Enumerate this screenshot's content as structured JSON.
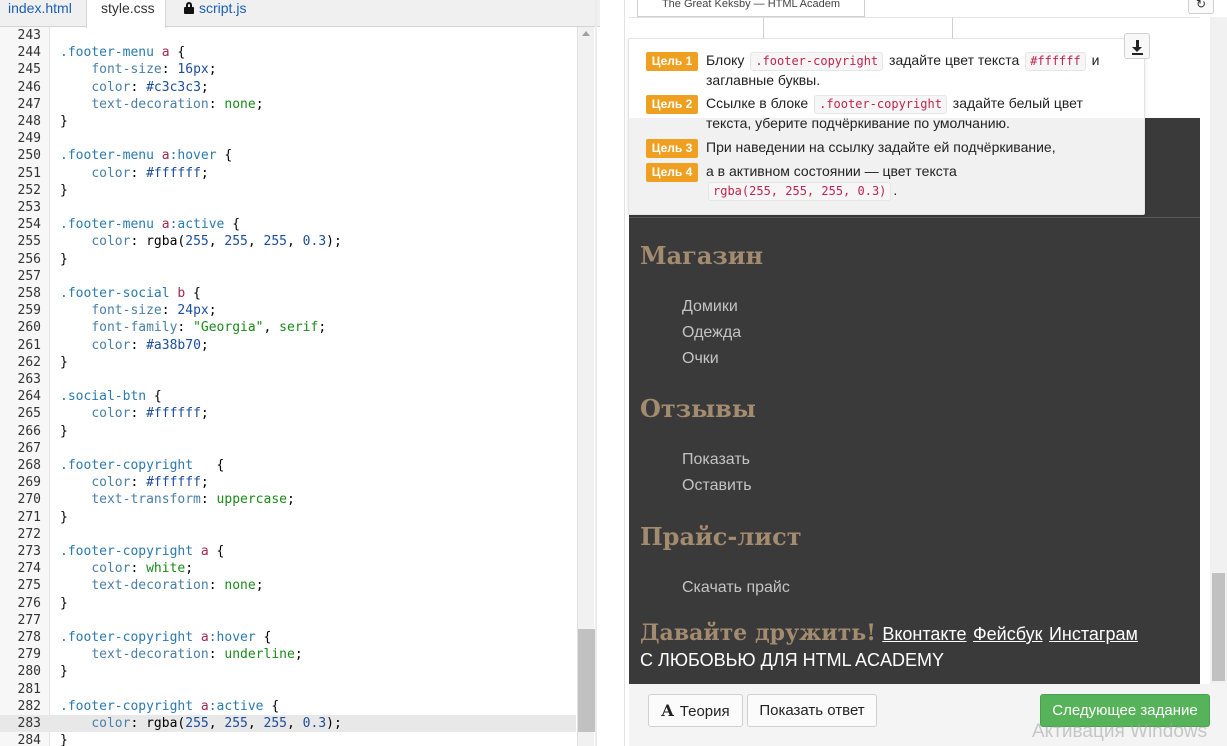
{
  "editor": {
    "tabs": [
      {
        "label": "index.html"
      },
      {
        "label": "style.css"
      },
      {
        "label": "script.js"
      }
    ],
    "lines": [
      {
        "n": "243",
        "tokens": []
      },
      {
        "n": "244",
        "tokens": [
          {
            "t": ".footer-menu",
            "c": "sel"
          },
          {
            "t": " "
          },
          {
            "t": "a",
            "c": "tag"
          },
          {
            "t": " {"
          }
        ]
      },
      {
        "n": "245",
        "tokens": [
          {
            "t": "    "
          },
          {
            "t": "font-size",
            "c": "prop"
          },
          {
            "t": ": "
          },
          {
            "t": "16px",
            "c": "num"
          },
          {
            "t": ";"
          }
        ]
      },
      {
        "n": "246",
        "tokens": [
          {
            "t": "    "
          },
          {
            "t": "color",
            "c": "prop"
          },
          {
            "t": ": "
          },
          {
            "t": "#c3c3c3",
            "c": "num"
          },
          {
            "t": ";"
          }
        ]
      },
      {
        "n": "247",
        "tokens": [
          {
            "t": "    "
          },
          {
            "t": "text-decoration",
            "c": "prop"
          },
          {
            "t": ": "
          },
          {
            "t": "none",
            "c": "kw"
          },
          {
            "t": ";"
          }
        ]
      },
      {
        "n": "248",
        "tokens": [
          {
            "t": "}"
          }
        ]
      },
      {
        "n": "249",
        "tokens": []
      },
      {
        "n": "250",
        "tokens": [
          {
            "t": ".footer-menu",
            "c": "sel"
          },
          {
            "t": " "
          },
          {
            "t": "a",
            "c": "tag"
          },
          {
            "t": ":hover",
            "c": "sel"
          },
          {
            "t": " {"
          }
        ]
      },
      {
        "n": "251",
        "tokens": [
          {
            "t": "    "
          },
          {
            "t": "color",
            "c": "prop"
          },
          {
            "t": ": "
          },
          {
            "t": "#ffffff",
            "c": "num"
          },
          {
            "t": ";"
          }
        ]
      },
      {
        "n": "252",
        "tokens": [
          {
            "t": "}"
          }
        ]
      },
      {
        "n": "253",
        "tokens": []
      },
      {
        "n": "254",
        "tokens": [
          {
            "t": ".footer-menu",
            "c": "sel"
          },
          {
            "t": " "
          },
          {
            "t": "a",
            "c": "tag"
          },
          {
            "t": ":active",
            "c": "sel"
          },
          {
            "t": " {"
          }
        ]
      },
      {
        "n": "255",
        "tokens": [
          {
            "t": "    "
          },
          {
            "t": "color",
            "c": "prop"
          },
          {
            "t": ": rgba("
          },
          {
            "t": "255",
            "c": "num"
          },
          {
            "t": ", "
          },
          {
            "t": "255",
            "c": "num"
          },
          {
            "t": ", "
          },
          {
            "t": "255",
            "c": "num"
          },
          {
            "t": ", "
          },
          {
            "t": "0.3",
            "c": "num"
          },
          {
            "t": ");"
          }
        ]
      },
      {
        "n": "256",
        "tokens": [
          {
            "t": "}"
          }
        ]
      },
      {
        "n": "257",
        "tokens": []
      },
      {
        "n": "258",
        "tokens": [
          {
            "t": ".footer-social",
            "c": "sel"
          },
          {
            "t": " "
          },
          {
            "t": "b",
            "c": "tag"
          },
          {
            "t": " {"
          }
        ]
      },
      {
        "n": "259",
        "tokens": [
          {
            "t": "    "
          },
          {
            "t": "font-size",
            "c": "prop"
          },
          {
            "t": ": "
          },
          {
            "t": "24px",
            "c": "num"
          },
          {
            "t": ";"
          }
        ]
      },
      {
        "n": "260",
        "tokens": [
          {
            "t": "    "
          },
          {
            "t": "font-family",
            "c": "prop"
          },
          {
            "t": ": "
          },
          {
            "t": "\"Georgia\"",
            "c": "str"
          },
          {
            "t": ", "
          },
          {
            "t": "serif",
            "c": "kw"
          },
          {
            "t": ";"
          }
        ]
      },
      {
        "n": "261",
        "tokens": [
          {
            "t": "    "
          },
          {
            "t": "color",
            "c": "prop"
          },
          {
            "t": ": "
          },
          {
            "t": "#a38b70",
            "c": "num"
          },
          {
            "t": ";"
          }
        ]
      },
      {
        "n": "262",
        "tokens": [
          {
            "t": "}"
          }
        ]
      },
      {
        "n": "263",
        "tokens": []
      },
      {
        "n": "264",
        "tokens": [
          {
            "t": ".social-btn",
            "c": "sel"
          },
          {
            "t": " {"
          }
        ]
      },
      {
        "n": "265",
        "tokens": [
          {
            "t": "    "
          },
          {
            "t": "color",
            "c": "prop"
          },
          {
            "t": ": "
          },
          {
            "t": "#ffffff",
            "c": "num"
          },
          {
            "t": ";"
          }
        ]
      },
      {
        "n": "266",
        "tokens": [
          {
            "t": "}"
          }
        ]
      },
      {
        "n": "267",
        "tokens": []
      },
      {
        "n": "268",
        "tokens": [
          {
            "t": ".footer-copyright",
            "c": "sel"
          },
          {
            "t": "   {"
          }
        ]
      },
      {
        "n": "269",
        "tokens": [
          {
            "t": "    "
          },
          {
            "t": "color",
            "c": "prop"
          },
          {
            "t": ": "
          },
          {
            "t": "#ffffff",
            "c": "num"
          },
          {
            "t": ";"
          }
        ]
      },
      {
        "n": "270",
        "tokens": [
          {
            "t": "    "
          },
          {
            "t": "text-transform",
            "c": "prop"
          },
          {
            "t": ": "
          },
          {
            "t": "uppercase",
            "c": "kw"
          },
          {
            "t": ";"
          }
        ]
      },
      {
        "n": "271",
        "tokens": [
          {
            "t": "}"
          }
        ]
      },
      {
        "n": "272",
        "tokens": []
      },
      {
        "n": "273",
        "tokens": [
          {
            "t": ".footer-copyright",
            "c": "sel"
          },
          {
            "t": " "
          },
          {
            "t": "a",
            "c": "tag"
          },
          {
            "t": " {"
          }
        ]
      },
      {
        "n": "274",
        "tokens": [
          {
            "t": "    "
          },
          {
            "t": "color",
            "c": "prop"
          },
          {
            "t": ": "
          },
          {
            "t": "white",
            "c": "kw"
          },
          {
            "t": ";"
          }
        ]
      },
      {
        "n": "275",
        "tokens": [
          {
            "t": "    "
          },
          {
            "t": "text-decoration",
            "c": "prop"
          },
          {
            "t": ": "
          },
          {
            "t": "none",
            "c": "kw"
          },
          {
            "t": ";"
          }
        ]
      },
      {
        "n": "276",
        "tokens": [
          {
            "t": "}"
          }
        ]
      },
      {
        "n": "277",
        "tokens": []
      },
      {
        "n": "278",
        "tokens": [
          {
            "t": ".footer-copyright",
            "c": "sel"
          },
          {
            "t": " "
          },
          {
            "t": "a",
            "c": "tag"
          },
          {
            "t": ":hover",
            "c": "sel"
          },
          {
            "t": " {"
          }
        ]
      },
      {
        "n": "279",
        "tokens": [
          {
            "t": "    "
          },
          {
            "t": "text-decoration",
            "c": "prop"
          },
          {
            "t": ": "
          },
          {
            "t": "underline",
            "c": "kw"
          },
          {
            "t": ";"
          }
        ]
      },
      {
        "n": "280",
        "tokens": [
          {
            "t": "}"
          }
        ]
      },
      {
        "n": "281",
        "tokens": []
      },
      {
        "n": "282",
        "tokens": [
          {
            "t": ".footer-copyright",
            "c": "sel"
          },
          {
            "t": " "
          },
          {
            "t": "a",
            "c": "tag"
          },
          {
            "t": ":active",
            "c": "sel"
          },
          {
            "t": " {"
          }
        ]
      },
      {
        "n": "283",
        "tokens": [
          {
            "t": "    "
          },
          {
            "t": "color",
            "c": "prop"
          },
          {
            "t": ": rgba("
          },
          {
            "t": "255",
            "c": "num"
          },
          {
            "t": ", "
          },
          {
            "t": "255",
            "c": "num"
          },
          {
            "t": ", "
          },
          {
            "t": "255",
            "c": "num"
          },
          {
            "t": ", "
          },
          {
            "t": "0.3",
            "c": "num"
          },
          {
            "t": ");"
          }
        ],
        "active": true
      },
      {
        "n": "284",
        "tokens": [
          {
            "t": "}"
          }
        ]
      }
    ]
  },
  "preview": {
    "browser_tab_title": "The Great Keksby — HTML Academ",
    "refresh_icon": "refresh-icon",
    "sections": [
      {
        "title": "Магазин",
        "links": [
          "Домики",
          "Одежда",
          "Очки"
        ]
      },
      {
        "title": "Отзывы",
        "links": [
          "Показать",
          "Оставить"
        ]
      },
      {
        "title": "Прайс-лист",
        "links": [
          "Скачать прайс"
        ]
      }
    ],
    "social": {
      "label": "Давайте дружить!",
      "buttons": [
        "Вконтакте",
        "Фейсбук",
        "Инстаграм"
      ]
    },
    "copyright": "С ЛЮБОВЬЮ ДЛЯ HTML ACADEMY",
    "colors": {
      "footer_bg": "#3a3a3a",
      "title": "#a38b70",
      "menu_link": "#c3c3c3"
    }
  },
  "tasks": [
    {
      "badge": "Цель 1",
      "parts": [
        {
          "t": "Блоку "
        },
        {
          "code": ".footer-copyright"
        },
        {
          "t": " задайте цвет текста "
        },
        {
          "code": "#ffffff"
        },
        {
          "t": " и заглавные буквы."
        }
      ]
    },
    {
      "badge": "Цель 2",
      "parts": [
        {
          "t": "Ссылке в блоке "
        },
        {
          "code": ".footer-copyright"
        },
        {
          "t": " задайте белый цвет текста, уберите подчёркивание по умолчанию."
        }
      ]
    },
    {
      "badge": "Цель 3",
      "parts": [
        {
          "t": "При наведении на ссылку задайте ей подчёркивание,"
        }
      ]
    },
    {
      "badge": "Цель 4",
      "parts": [
        {
          "t": "а в активном состоянии — цвет текста "
        },
        {
          "code": "rgba(255, 255, 255, 0.3)"
        },
        {
          "t": "."
        }
      ]
    }
  ],
  "toolbar": {
    "theory_label": "Теория",
    "theory_icon": "A",
    "answer_label": "Показать ответ",
    "next_label": "Следующее задание",
    "next_color": "#57b35a"
  },
  "watermark": "Активация Windows"
}
